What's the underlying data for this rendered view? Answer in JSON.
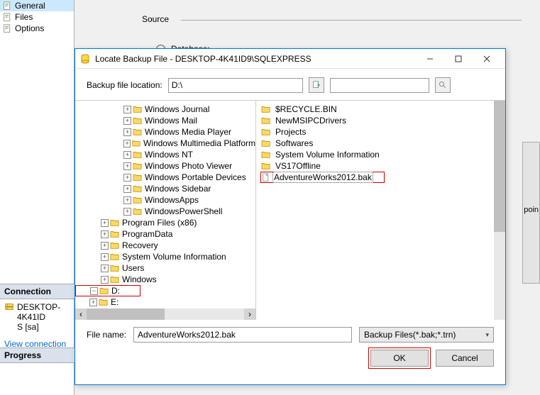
{
  "sidebar": {
    "items": [
      {
        "label": "General",
        "selected": true
      },
      {
        "label": "Files",
        "selected": false
      },
      {
        "label": "Options",
        "selected": false
      }
    ]
  },
  "connection": {
    "header": "Connection",
    "server": "DESKTOP-4K41ID\nS [sa]",
    "link": "View connection pro"
  },
  "progress_header": "Progress",
  "source": {
    "label": "Source",
    "database_label": "Database:"
  },
  "right_strip_text": "poin",
  "dialog": {
    "title": "Locate Backup File - DESKTOP-4K41ID9\\SQLEXPRESS",
    "location_label": "Backup file location:",
    "location_path": "D:\\",
    "tree": {
      "indent3": [
        "Windows Journal",
        "Windows Mail",
        "Windows Media Player",
        "Windows Multimedia Platform",
        "Windows NT",
        "Windows Photo Viewer",
        "Windows Portable Devices",
        "Windows Sidebar",
        "WindowsApps",
        "WindowsPowerShell"
      ],
      "indent2": [
        "Program Files (x86)",
        "ProgramData",
        "Recovery",
        "System Volume Information",
        "Users",
        "Windows"
      ],
      "drives": [
        "D:",
        "E:"
      ]
    },
    "folders": [
      "$RECYCLE.BIN",
      "NewMSIPCDrivers",
      "Projects",
      "Softwares",
      "System Volume Information",
      "VS17Offline"
    ],
    "selected_file": "AdventureWorks2012.bak",
    "filename_label": "File name:",
    "filename_value": "AdventureWorks2012.bak",
    "filetype": "Backup Files(*.bak;*.trn)",
    "ok": "OK",
    "cancel": "Cancel"
  }
}
